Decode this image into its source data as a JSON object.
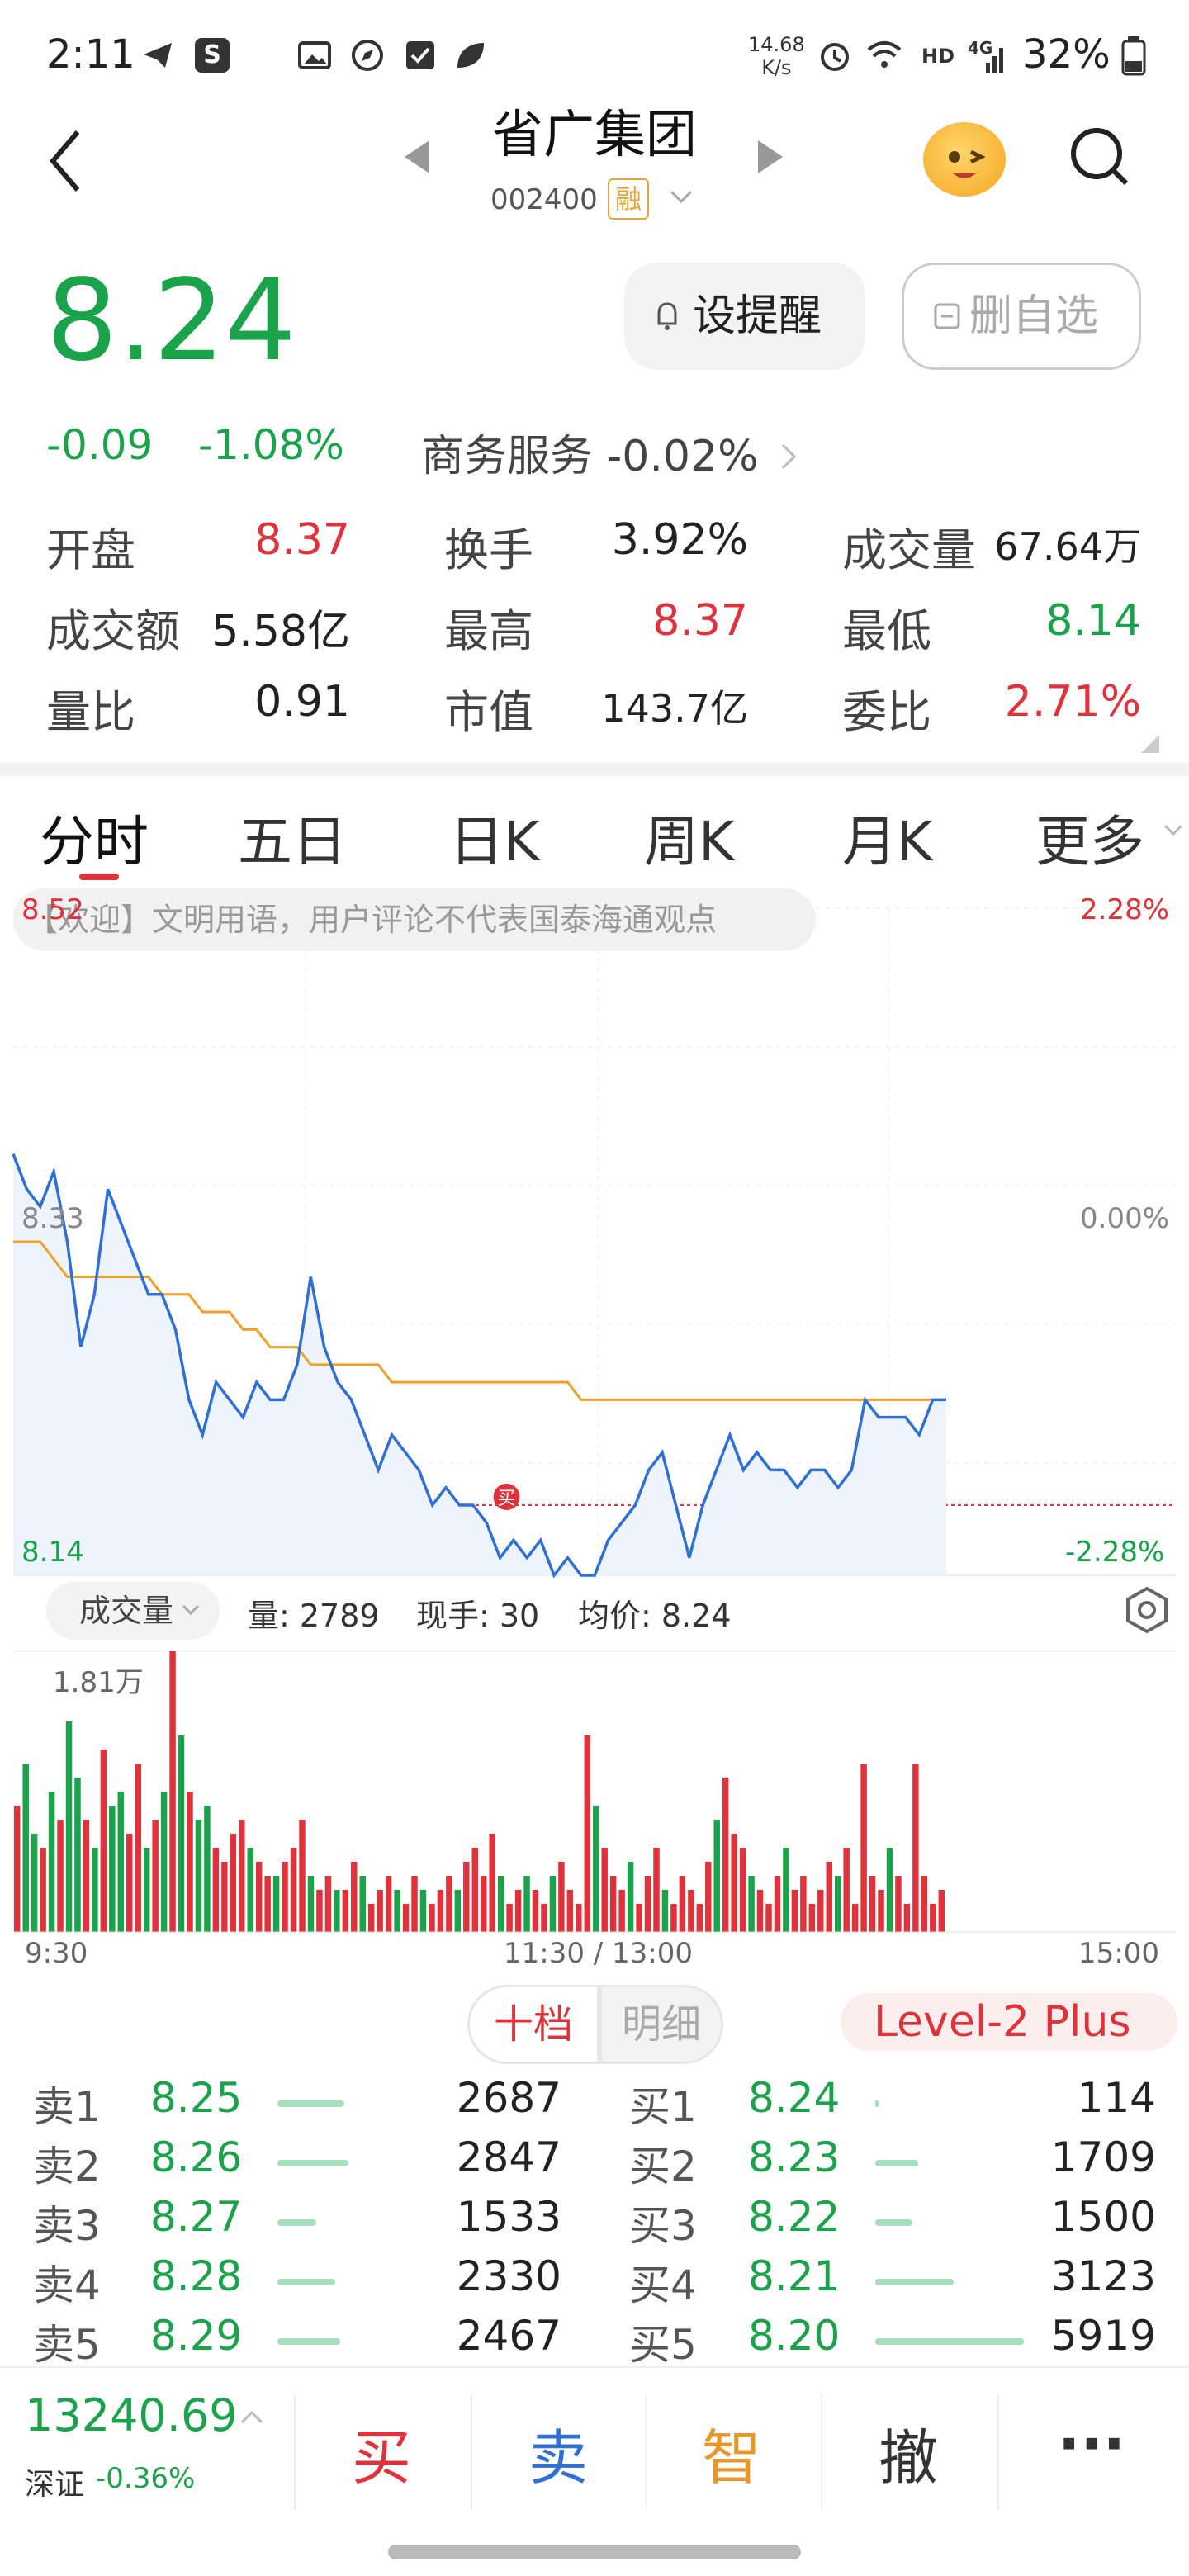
{
  "status_bar": {
    "time": "2:11",
    "net_speed_top": "14.68",
    "net_speed_unit": "K/s",
    "signal": "HD",
    "network": "4G",
    "battery": "32%"
  },
  "header": {
    "title": "省广集团",
    "code": "002400",
    "badge": "融"
  },
  "quote": {
    "price": "8.24",
    "change": "-0.09",
    "change_pct": "-1.08%",
    "sector": "商务服务 -0.02%",
    "remind_label": "设提醒",
    "delete_label": "删自选"
  },
  "stats": [
    {
      "label": "开盘",
      "value": "8.37",
      "color": "red"
    },
    {
      "label": "换手",
      "value": "3.92%",
      "color": "dark"
    },
    {
      "label": "成交量",
      "value": "67.64万",
      "color": "dark"
    },
    {
      "label": "成交额",
      "value": "5.58亿",
      "color": "dark"
    },
    {
      "label": "最高",
      "value": "8.37",
      "color": "red"
    },
    {
      "label": "最低",
      "value": "8.14",
      "color": "green"
    },
    {
      "label": "量比",
      "value": "0.91",
      "color": "dark"
    },
    {
      "label": "市值",
      "value": "143.7亿",
      "color": "dark"
    },
    {
      "label": "委比",
      "value": "2.71%",
      "color": "red"
    }
  ],
  "tabs": [
    "分时",
    "五日",
    "日K",
    "周K",
    "月K",
    "更多"
  ],
  "chart": {
    "notice": "【欢迎】文明用语，用户评论不代表国泰海通观点",
    "y_top_left": "8.52",
    "y_mid_left": "8.33",
    "y_bottom_left": "8.14",
    "y_top_right": "2.28%",
    "y_mid_right": "0.00%",
    "y_bottom_right": "-2.28%",
    "buy_marker": "买",
    "vol_select": "成交量",
    "vol_info": "量: 2789",
    "hand_info": "现手: 30",
    "avg_info": "均价: 8.24",
    "vol_max": "1.81万",
    "x_start": "9:30",
    "x_mid": "11:30 / 13:00",
    "x_end": "15:00"
  },
  "chart_data": {
    "type": "line",
    "series": [
      {
        "values": [
          8.38,
          8.36,
          8.35,
          8.37,
          8.33,
          8.27,
          8.3,
          8.36,
          8.34,
          8.32,
          8.3,
          8.3,
          8.28,
          8.24,
          8.22,
          8.25,
          8.24,
          8.23,
          8.25,
          8.24,
          8.24,
          8.26,
          8.31,
          8.27,
          8.25,
          8.24,
          8.22,
          8.2,
          8.22,
          8.21,
          8.2,
          8.18,
          8.19,
          8.18,
          8.18,
          8.17,
          8.15,
          8.16,
          8.15,
          8.16,
          8.14,
          8.15,
          8.14,
          8.14,
          8.16,
          8.17,
          8.18,
          8.2,
          8.21,
          8.18,
          8.15,
          8.18,
          8.2,
          8.22,
          8.2,
          8.21,
          8.2,
          8.2,
          8.19,
          8.2,
          8.2,
          8.19,
          8.2,
          8.24,
          8.23,
          8.23,
          8.23,
          8.22,
          8.24,
          8.24
        ]
      },
      {
        "values": [
          8.33,
          8.33,
          8.33,
          8.32,
          8.31,
          8.31,
          8.31,
          8.31,
          8.31,
          8.31,
          8.31,
          8.3,
          8.3,
          8.3,
          8.29,
          8.29,
          8.29,
          8.28,
          8.28,
          8.27,
          8.27,
          8.27,
          8.26,
          8.26,
          8.26,
          8.26,
          8.26,
          8.26,
          8.25,
          8.25,
          8.25,
          8.25,
          8.25,
          8.25,
          8.25,
          8.25,
          8.25,
          8.25,
          8.25,
          8.25,
          8.25,
          8.25,
          8.24,
          8.24,
          8.24,
          8.24,
          8.24,
          8.24,
          8.24,
          8.24,
          8.24,
          8.24,
          8.24,
          8.24,
          8.24,
          8.24,
          8.24,
          8.24,
          8.24,
          8.24,
          8.24,
          8.24,
          8.24,
          8.24,
          8.24,
          8.24,
          8.24,
          8.24,
          8.24,
          8.24
        ]
      }
    ],
    "ylim": [
      8.14,
      8.52
    ],
    "reference_line": 8.18
  },
  "volume_data": {
    "values": [
      0.45,
      0.6,
      0.35,
      0.3,
      0.5,
      0.4,
      0.75,
      0.55,
      0.4,
      0.3,
      0.65,
      0.45,
      0.5,
      0.35,
      0.6,
      0.3,
      0.4,
      0.5,
      1.0,
      0.7,
      0.5,
      0.4,
      0.45,
      0.3,
      0.25,
      0.35,
      0.4,
      0.3,
      0.25,
      0.2,
      0.2,
      0.25,
      0.3,
      0.4,
      0.2,
      0.15,
      0.2,
      0.15,
      0.15,
      0.25,
      0.2,
      0.1,
      0.15,
      0.2,
      0.15,
      0.1,
      0.2,
      0.15,
      0.1,
      0.15,
      0.2,
      0.15,
      0.25,
      0.3,
      0.2,
      0.35,
      0.2,
      0.1,
      0.15,
      0.2,
      0.15,
      0.1,
      0.2,
      0.25,
      0.15,
      0.1,
      0.7,
      0.45,
      0.3,
      0.2,
      0.15,
      0.25,
      0.1,
      0.2,
      0.3,
      0.15,
      0.1,
      0.2,
      0.15,
      0.1,
      0.25,
      0.4,
      0.55,
      0.35,
      0.3,
      0.2,
      0.15,
      0.1,
      0.2,
      0.3,
      0.15,
      0.2,
      0.1,
      0.15,
      0.25,
      0.2,
      0.3,
      0.1,
      0.6,
      0.2,
      0.15,
      0.3,
      0.2,
      0.1,
      0.6,
      0.2,
      0.1,
      0.15
    ],
    "colors_up": [
      0,
      1,
      1,
      0,
      1,
      0,
      1,
      1,
      0,
      1,
      0,
      1,
      1,
      0,
      0,
      1,
      0,
      1,
      0,
      1,
      0,
      1,
      1,
      0,
      0,
      0,
      0,
      1,
      0,
      0,
      1,
      0,
      0,
      0,
      1,
      0,
      0,
      1,
      0,
      0,
      1,
      0,
      0,
      0,
      1,
      0,
      0,
      1,
      0,
      0,
      0,
      1,
      0,
      0,
      0,
      0,
      1,
      0,
      0,
      1,
      0,
      0,
      1,
      0,
      0,
      0,
      0,
      1,
      0,
      0,
      0,
      1,
      0,
      0,
      0,
      1,
      0,
      0,
      0,
      0,
      0,
      1,
      0,
      0,
      0,
      1,
      0,
      0,
      0,
      1,
      0,
      0,
      0,
      0,
      0,
      1,
      0,
      0,
      0,
      0,
      0,
      1,
      0,
      0,
      0,
      0,
      0,
      0
    ]
  },
  "order_book": {
    "tab_10": "十档",
    "tab_detail": "明细",
    "level2": "Level-2 Plus",
    "sell": [
      {
        "label": "卖1",
        "price": "8.25",
        "vol": "2687",
        "ratio": 0.45
      },
      {
        "label": "卖2",
        "price": "8.26",
        "vol": "2847",
        "ratio": 0.48
      },
      {
        "label": "卖3",
        "price": "8.27",
        "vol": "1533",
        "ratio": 0.26
      },
      {
        "label": "卖4",
        "price": "8.28",
        "vol": "2330",
        "ratio": 0.39
      },
      {
        "label": "卖5",
        "price": "8.29",
        "vol": "2467",
        "ratio": 0.42
      }
    ],
    "buy": [
      {
        "label": "买1",
        "price": "8.24",
        "vol": "114",
        "ratio": 0.02
      },
      {
        "label": "买2",
        "price": "8.23",
        "vol": "1709",
        "ratio": 0.29
      },
      {
        "label": "买3",
        "price": "8.22",
        "vol": "1500",
        "ratio": 0.25
      },
      {
        "label": "买4",
        "price": "8.21",
        "vol": "3123",
        "ratio": 0.53
      },
      {
        "label": "买5",
        "price": "8.20",
        "vol": "5919",
        "ratio": 1.0
      }
    ]
  },
  "bottom_bar": {
    "index_value": "13240.69",
    "index_name": "深证",
    "index_pct": "-0.36%",
    "buy": "买",
    "sell": "卖",
    "smart": "智",
    "cancel": "撤",
    "more": "···"
  }
}
